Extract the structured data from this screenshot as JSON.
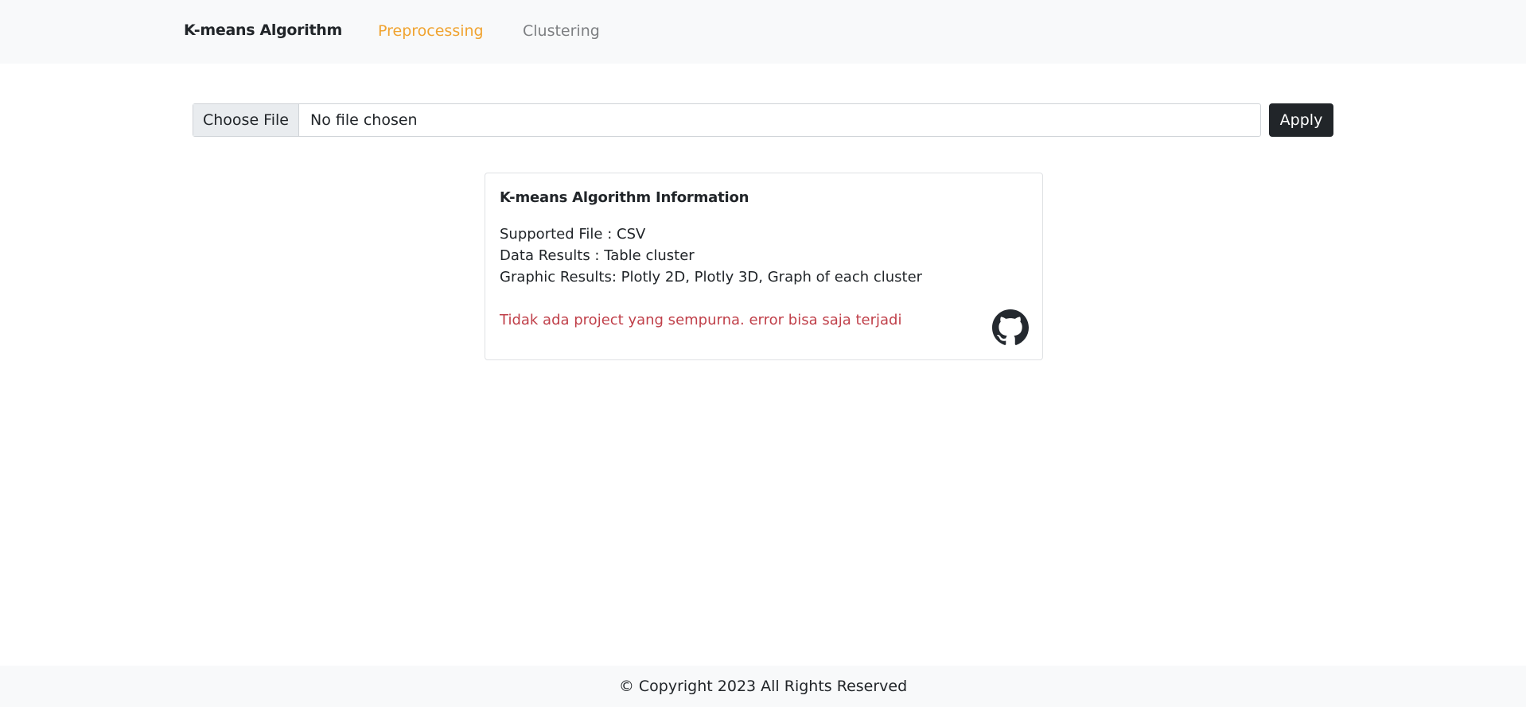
{
  "navbar": {
    "brand": "K-means Algorithm",
    "links": [
      {
        "label": "Preprocessing",
        "color": "#f0a330",
        "active": true
      },
      {
        "label": "Clustering",
        "color": "#7d7f82",
        "active": false
      }
    ]
  },
  "upload": {
    "choose_label": "Choose File",
    "status_text": "No file chosen",
    "apply_label": "Apply"
  },
  "info_card": {
    "title": "K-means Algorithm Information",
    "lines": [
      "Supported File : CSV",
      "Data Results : Table cluster",
      "Graphic Results: Plotly 2D, Plotly 3D, Graph of each cluster"
    ],
    "warning": "Tidak ada project yang sempurna. error bisa saja terjadi",
    "warning_color": "#c0404a",
    "icon": "github-icon"
  },
  "footer": {
    "text": "© Copyright 2023 All Rights Reserved"
  }
}
